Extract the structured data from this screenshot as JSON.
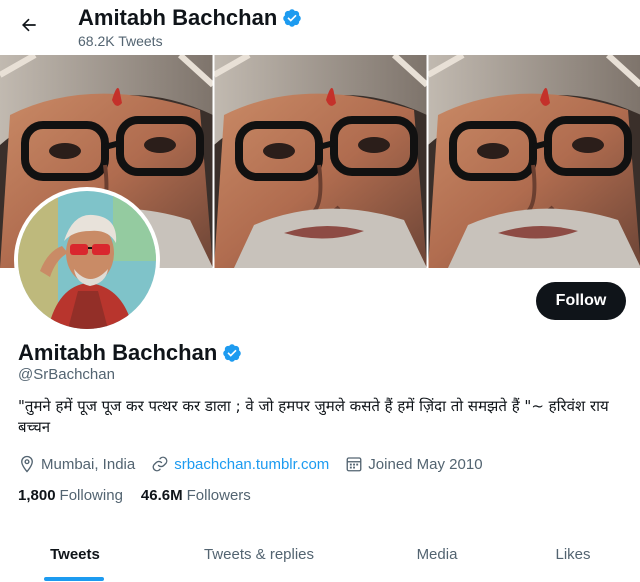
{
  "header": {
    "name": "Amitabh Bachchan",
    "tweet_count": "68.2K Tweets"
  },
  "profile": {
    "name": "Amitabh Bachchan",
    "handle": "@SrBachchan",
    "bio": "\"तुमने हमें पूज पूज कर पत्थर कर डाला ; वे जो हमपर जुमले कसते हैं हमें ज़िंदा तो समझते हैं \"~ हरिवंश राय बच्चन",
    "location": "Mumbai, India",
    "website": "srbachchan.tumblr.com",
    "joined": "Joined May 2010",
    "following_count": "1,800",
    "following_label": "Following",
    "followers_count": "46.6M",
    "followers_label": "Followers",
    "follow_button": "Follow"
  },
  "tabs": [
    {
      "label": "Tweets",
      "active": true
    },
    {
      "label": "Tweets & replies",
      "active": false
    },
    {
      "label": "Media",
      "active": false
    },
    {
      "label": "Likes",
      "active": false
    }
  ],
  "colors": {
    "accent": "#1d9bf0",
    "text_primary": "#0f1419",
    "text_secondary": "#536471",
    "verified_badge": "#1d9bf0"
  },
  "icons": {
    "back": "arrow-left-icon",
    "verified": "verified-badge-icon",
    "location": "location-pin-icon",
    "link": "link-icon",
    "calendar": "calendar-icon"
  }
}
